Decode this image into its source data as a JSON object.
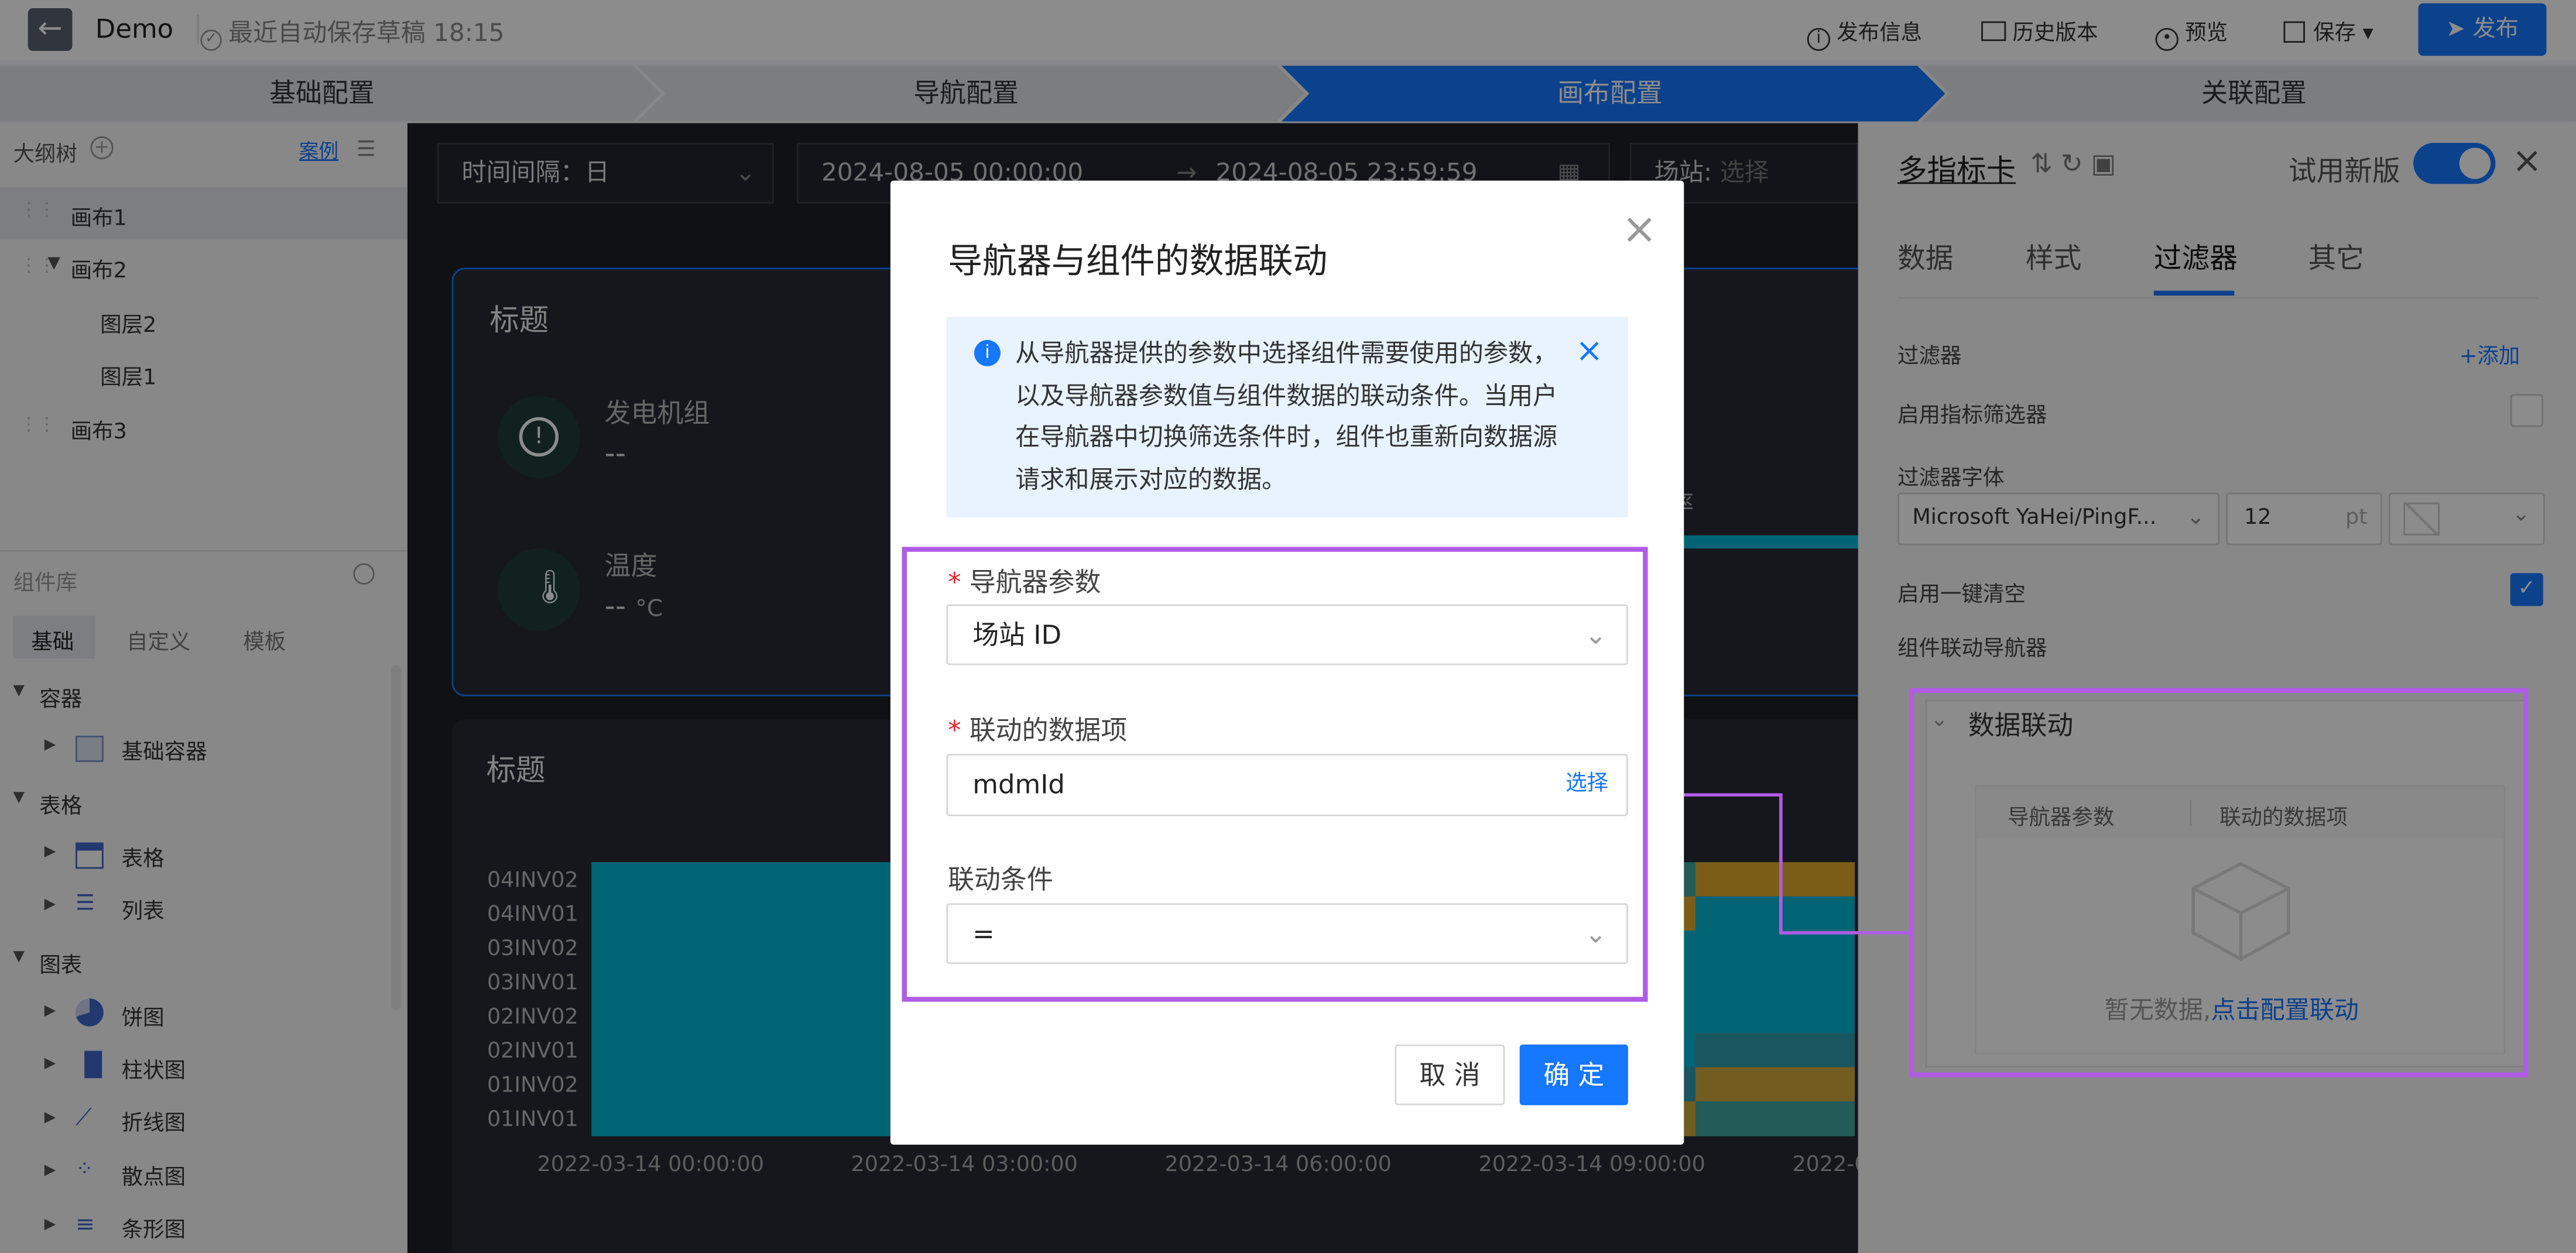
{
  "topbar": {
    "back_icon": "arrow-left-icon",
    "app_name": "Demo",
    "autosave": "最近自动保存草稿 18:15",
    "publish_info": "发布信息",
    "history": "历史版本",
    "preview": "预览",
    "save": "保存",
    "publish": "发布"
  },
  "steps": [
    "基础配置",
    "导航配置",
    "画布配置",
    "关联配置"
  ],
  "outline": {
    "title": "大纲树",
    "case_link": "案例",
    "items": [
      "画布1",
      "画布2",
      "图层2",
      "图层1",
      "画布3"
    ]
  },
  "library": {
    "search_placeholder": "组件库",
    "tabs": [
      "基础",
      "自定义",
      "模板"
    ],
    "groups": [
      {
        "name": "容器",
        "items": [
          "基础容器"
        ]
      },
      {
        "name": "表格",
        "items": [
          "表格",
          "列表"
        ]
      },
      {
        "name": "图表",
        "items": [
          "饼图",
          "柱状图",
          "折线图",
          "散点图",
          "条形图"
        ]
      }
    ]
  },
  "canvas": {
    "interval": "时间间隔：日",
    "start_time": "2024-08-05 00:00:00",
    "arrow": "→",
    "end_time": "2024-08-05 23:59:59",
    "station_label": "场站:",
    "station_placeholder": "选择",
    "card1_title": "标题",
    "metric1_label": "发电机组",
    "metric1_value": "--",
    "metric2_label": "温度",
    "metric2_value": "--",
    "metric2_unit": "°C",
    "partial_text": "率",
    "card2_title": "标题",
    "chart_data": {
      "type": "heatmap",
      "categories": [
        "04INV02",
        "04INV01",
        "03INV02",
        "03INV01",
        "02INV02",
        "02INV01",
        "01INV02",
        "01INV01"
      ],
      "x_ticks": [
        "2022-03-14 00:00:00",
        "2022-03-14 03:00:00",
        "2022-03-14 06:00:00",
        "2022-03-14 09:00:00",
        "2022-0"
      ]
    }
  },
  "rightpanel": {
    "title": "多指标卡",
    "trial": "试用新版",
    "tabs": [
      "数据",
      "样式",
      "过滤器",
      "其它"
    ],
    "filter_label": "过滤器",
    "add": "+添加",
    "enable_filter": "启用指标筛选器",
    "filter_font": "过滤器字体",
    "font_name": "Microsoft YaHei/PingF...",
    "font_size": "12",
    "font_unit": "pt",
    "enable_clear": "启用一键清空",
    "linked_nav": "组件联动导航器",
    "data_link": "数据联动",
    "col1": "导航器参数",
    "col2": "联动的数据项",
    "empty_text": "暂无数据,",
    "empty_link": "点击配置联动"
  },
  "modal": {
    "title": "导航器与组件的数据联动",
    "info": "从导航器提供的参数中选择组件需要使用的参数，以及导航器参数值与组件数据的联动条件。当用户在导航器中切换筛选条件时，组件也重新向数据源请求和展示对应的数据。",
    "param_label": "导航器参数",
    "param_value": "场站 ID",
    "item_label": "联动的数据项",
    "item_value": "mdmId",
    "select": "选择",
    "cond_label": "联动条件",
    "cond_value": "=",
    "cancel": "取 消",
    "ok": "确 定",
    "required": "*"
  },
  "colors": {
    "primary": "#1677ff",
    "highlight": "#b05ce6",
    "heat_cyan": "#00b6d6",
    "heat_yellow": "#e0a92c"
  }
}
